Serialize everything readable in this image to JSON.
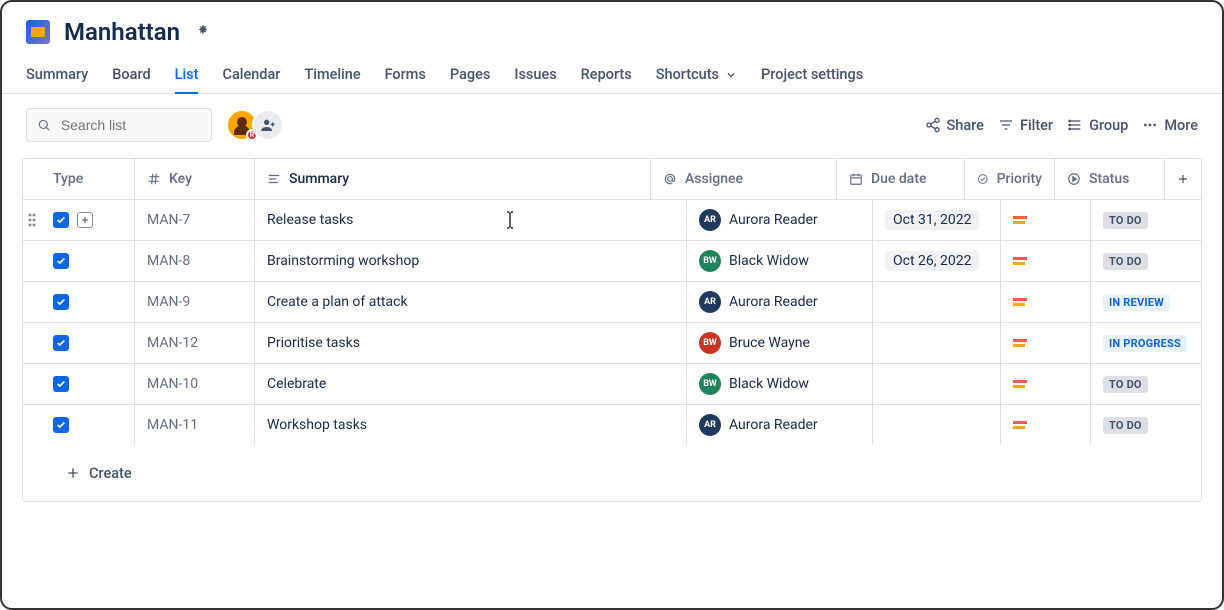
{
  "project": {
    "title": "Manhattan"
  },
  "tabs": [
    {
      "label": "Summary",
      "active": false
    },
    {
      "label": "Board",
      "active": false
    },
    {
      "label": "List",
      "active": true
    },
    {
      "label": "Calendar",
      "active": false
    },
    {
      "label": "Timeline",
      "active": false
    },
    {
      "label": "Forms",
      "active": false
    },
    {
      "label": "Pages",
      "active": false
    },
    {
      "label": "Issues",
      "active": false
    },
    {
      "label": "Reports",
      "active": false
    },
    {
      "label": "Shortcuts",
      "active": false,
      "hasDropdown": true
    },
    {
      "label": "Project settings",
      "active": false
    }
  ],
  "search": {
    "placeholder": "Search list"
  },
  "toolbar": {
    "share": "Share",
    "filter": "Filter",
    "group": "Group",
    "more": "More"
  },
  "columns": {
    "type": "Type",
    "key": "Key",
    "summary": "Summary",
    "assignee": "Assignee",
    "duedate": "Due date",
    "priority": "Priority",
    "status": "Status"
  },
  "rows": [
    {
      "key": "MAN-7",
      "summary": "Release tasks",
      "assignee": {
        "name": "Aurora Reader",
        "initials": "AR",
        "color": "#1F3A5F"
      },
      "duedate": "Oct 31, 2022",
      "status": {
        "label": "TO DO",
        "class": "status-todo"
      },
      "editing": true,
      "hovered": true
    },
    {
      "key": "MAN-8",
      "summary": "Brainstorming workshop",
      "assignee": {
        "name": "Black Widow",
        "initials": "BW",
        "color": "#1F845A"
      },
      "duedate": "Oct 26, 2022",
      "status": {
        "label": "TO DO",
        "class": "status-todo"
      }
    },
    {
      "key": "MAN-9",
      "summary": "Create a plan of attack",
      "assignee": {
        "name": "Aurora Reader",
        "initials": "AR",
        "color": "#1F3A5F"
      },
      "duedate": "",
      "status": {
        "label": "IN REVIEW",
        "class": "status-review"
      }
    },
    {
      "key": "MAN-12",
      "summary": "Prioritise tasks",
      "assignee": {
        "name": "Bruce Wayne",
        "initials": "BW",
        "color": "#CA3521"
      },
      "duedate": "",
      "status": {
        "label": "IN PROGRESS",
        "class": "status-progress"
      }
    },
    {
      "key": "MAN-10",
      "summary": "Celebrate",
      "assignee": {
        "name": "Black Widow",
        "initials": "BW",
        "color": "#1F845A"
      },
      "duedate": "",
      "status": {
        "label": "TO DO",
        "class": "status-todo"
      }
    },
    {
      "key": "MAN-11",
      "summary": "Workshop tasks",
      "assignee": {
        "name": "Aurora Reader",
        "initials": "AR",
        "color": "#1F3A5F"
      },
      "duedate": "",
      "status": {
        "label": "TO DO",
        "class": "status-todo"
      }
    }
  ],
  "create": {
    "label": "Create"
  },
  "avatarBadge": "R"
}
